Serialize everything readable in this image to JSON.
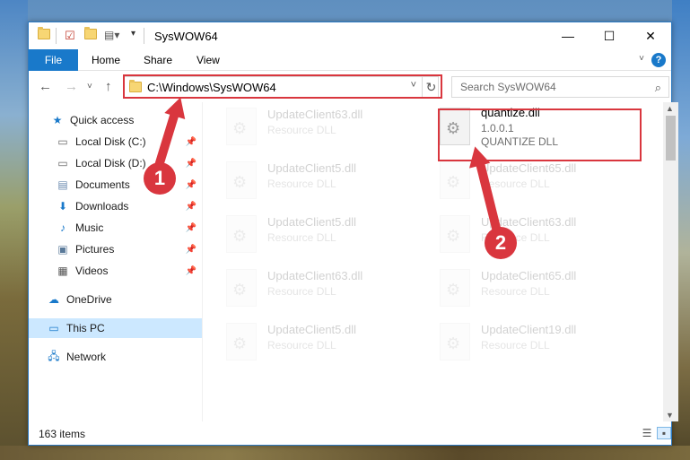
{
  "window": {
    "title": "SysWOW64",
    "minimize": "—",
    "maximize": "☐",
    "close": "✕"
  },
  "ribbon": {
    "file": "File",
    "home": "Home",
    "share": "Share",
    "view": "View",
    "help": "?"
  },
  "nav": {
    "back": "←",
    "forward": "→",
    "recent": "˅",
    "up": "↑",
    "address": "C:\\Windows\\SysWOW64",
    "dropdown": "˅",
    "refresh": "↻",
    "search_placeholder": "Search SysWOW64",
    "search_icon": "⌕"
  },
  "sidebar": {
    "items": [
      {
        "label": "Quick access",
        "icon": "star-icon"
      },
      {
        "label": "Local Disk (C:)",
        "icon": "drive-icon"
      },
      {
        "label": "Local Disk (D:)",
        "icon": "drive-icon"
      },
      {
        "label": "Documents",
        "icon": "documents-icon"
      },
      {
        "label": "Downloads",
        "icon": "download-icon"
      },
      {
        "label": "Music",
        "icon": "music-icon"
      },
      {
        "label": "Pictures",
        "icon": "pictures-icon"
      },
      {
        "label": "Videos",
        "icon": "videos-icon"
      },
      {
        "label": "OneDrive",
        "icon": "cloud-icon"
      },
      {
        "label": "This PC",
        "icon": "computer-icon"
      },
      {
        "label": "Network",
        "icon": "network-icon"
      }
    ]
  },
  "files": {
    "highlighted": {
      "name": "quantize.dll",
      "version": "1.0.0.1",
      "description": "QUANTIZE DLL"
    },
    "left": [
      {
        "name": "UpdateClient63.dll",
        "type": "Resource DLL"
      },
      {
        "name": "UpdateClient5.dll",
        "type": "Resource DLL"
      },
      {
        "name": "UpdateClient5.dll",
        "type": "Resource DLL"
      },
      {
        "name": "UpdateClient63.dll",
        "type": "Resource DLL"
      },
      {
        "name": "UpdateClient5.dll",
        "type": "Resource DLL"
      }
    ],
    "right": [
      {
        "name": "UpdateClient65.dll",
        "type": "Resource DLL"
      },
      {
        "name": "UpdateClient63.dll",
        "type": "Resource DLL"
      },
      {
        "name": "UpdateClient65.dll",
        "type": "Resource DLL"
      },
      {
        "name": "UpdateClient19.dll",
        "type": "Resource DLL"
      }
    ]
  },
  "status": {
    "count": "163 items"
  },
  "annotations": {
    "step1": "1",
    "step2": "2",
    "color": "#d9363e"
  },
  "colors": {
    "accent": "#1979ca",
    "selection": "#cce8ff"
  }
}
